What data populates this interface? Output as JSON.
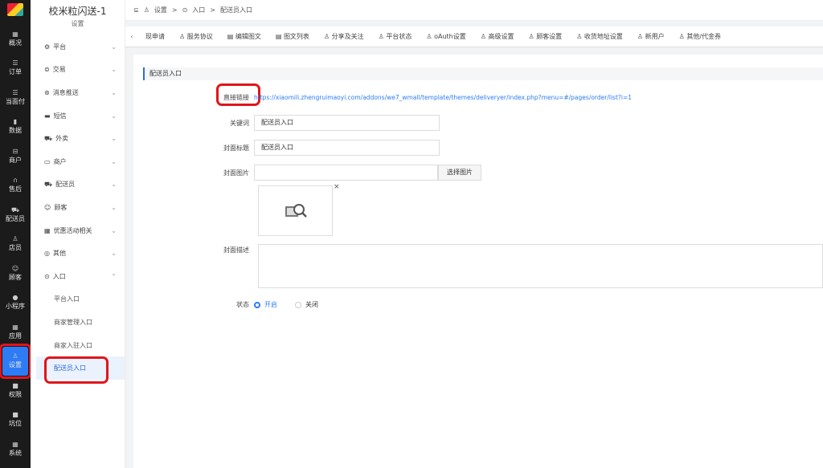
{
  "rail": {
    "items": [
      {
        "icon": "▦",
        "label": "概况"
      },
      {
        "icon": "☰",
        "label": "订单"
      },
      {
        "icon": "☰",
        "label": "当面付"
      },
      {
        "icon": "▮",
        "label": "数据"
      },
      {
        "icon": "⊟",
        "label": "商户"
      },
      {
        "icon": "∩",
        "label": "售后"
      },
      {
        "icon": "⛟",
        "label": "配送员"
      },
      {
        "icon": "♙",
        "label": "店员"
      },
      {
        "icon": "☺",
        "label": "顾客"
      },
      {
        "icon": "●",
        "label": "小程序"
      },
      {
        "icon": "▦",
        "label": "应用"
      },
      {
        "icon": "♙",
        "label": "设置"
      },
      {
        "icon": "■",
        "label": "权限"
      },
      {
        "icon": "■",
        "label": "坑位"
      },
      {
        "icon": "▦",
        "label": "系统"
      }
    ]
  },
  "sidebar": {
    "title": "校米粒闪送-1",
    "subtitle": "设置",
    "menu": [
      {
        "icon": "⚙",
        "label": "平台"
      },
      {
        "icon": "⊜",
        "label": "交易"
      },
      {
        "icon": "⊛",
        "label": "消息推送"
      },
      {
        "icon": "▬",
        "label": "短信"
      },
      {
        "icon": "⛟",
        "label": "外卖"
      },
      {
        "icon": "▭",
        "label": "商户"
      },
      {
        "icon": "⛟",
        "label": "配送员"
      },
      {
        "icon": "☺",
        "label": "顾客"
      },
      {
        "icon": "▦",
        "label": "优惠活动相关"
      },
      {
        "icon": "◎",
        "label": "其他"
      },
      {
        "icon": "⊙",
        "label": "入口"
      }
    ],
    "sub": [
      "平台入口",
      "商家管理入口",
      "商家入驻入口",
      "配送员入口"
    ]
  },
  "breadcrumb": {
    "collapse": "⊆",
    "settings": "设置",
    "entry": "入口",
    "current": "配送员入口",
    "sep": ">"
  },
  "tabs": [
    "现申请",
    "服务协议",
    "编辑图文",
    "图文列表",
    "分享及关注",
    "平台状态",
    "oAuth设置",
    "高级设置",
    "顾客设置",
    "收货地址设置",
    "新用户",
    "其他/代金券"
  ],
  "form": {
    "section_title": "配送员入口",
    "link_label": "直接链接",
    "link_value": "https://xiaomili.zhengruimaoyi.com/addons/we7_wmall/template/themes/deliveryer/index.php?menu=#/pages/order/list?i=1",
    "keyword_label": "关键词",
    "keyword_value": "配送员入口",
    "cover_title_label": "封面标题",
    "cover_title_value": "配送员入口",
    "cover_image_label": "封面图片",
    "select_image_btn": "选择图片",
    "remove": "×",
    "cover_desc_label": "封面描述",
    "status_label": "状态",
    "status_on": "开启",
    "status_off": "关闭"
  }
}
